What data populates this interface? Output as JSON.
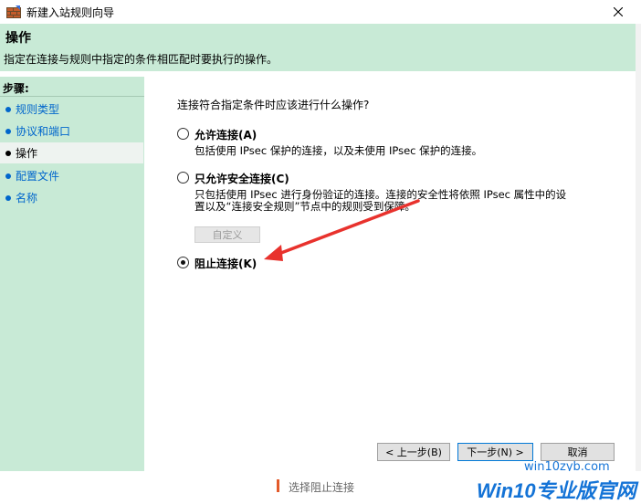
{
  "window": {
    "title": "新建入站规则向导"
  },
  "header": {
    "title": "操作",
    "description": "指定在连接与规则中指定的条件相匹配时要执行的操作。"
  },
  "steps": {
    "heading": "步骤:",
    "items": [
      {
        "label": "规则类型"
      },
      {
        "label": "协议和端口"
      },
      {
        "label": "操作"
      },
      {
        "label": "配置文件"
      },
      {
        "label": "名称"
      }
    ]
  },
  "main": {
    "question": "连接符合指定条件时应该进行什么操作?",
    "options": [
      {
        "label": "允许连接(A)",
        "desc_line1": "包括使用 IPsec 保护的连接，以及未使用 IPsec 保护的连接。",
        "checked": false
      },
      {
        "label": "只允许安全连接(C)",
        "desc_line1": "只包括使用 IPsec 进行身份验证的连接。连接的安全性将依照 IPsec 属性中的设",
        "desc_line2": "置以及“连接安全规则”节点中的规则受到保障。",
        "checked": false
      },
      {
        "label": "阻止连接(K)",
        "checked": true
      }
    ],
    "custom_button": "自定义"
  },
  "buttons": {
    "back": "< 上一步(B)",
    "next": "下一步(N) >",
    "cancel": "取消"
  },
  "caption": {
    "text": "选择阻止连接"
  },
  "watermark": {
    "brand": "Win10专业版官网",
    "url": "win10zyb.com"
  },
  "colors": {
    "panel_green": "#c8ead6",
    "link_blue": "#0066cc",
    "arrow_red": "#e8322d",
    "watermark_blue": "#1473d6"
  }
}
